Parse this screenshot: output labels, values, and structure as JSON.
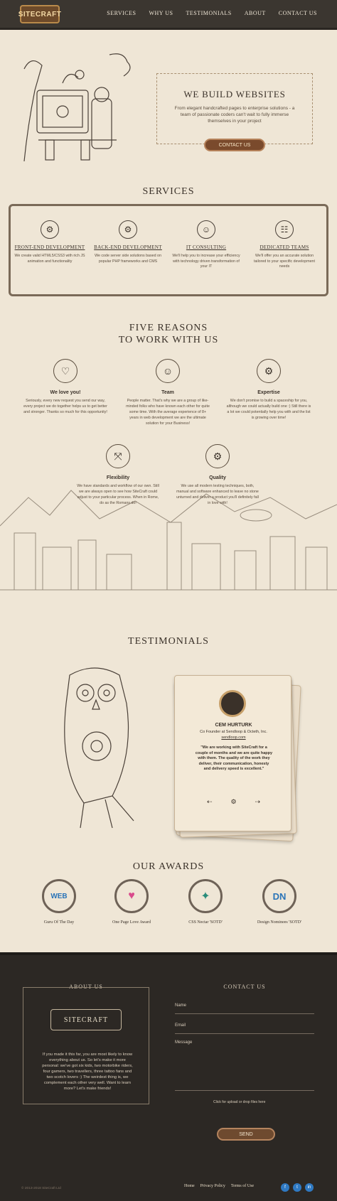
{
  "nav": {
    "logo_text": "SITECRAFT",
    "items": [
      "SERVICES",
      "WHY US",
      "TESTIMONIALS",
      "ABOUT",
      "CONTACT US"
    ]
  },
  "hero": {
    "title": "WE BUILD WEBSITES",
    "text": "From elegant handcrafted pages to enterprise solutions - a team of passionate coders can't wait to fully immerse themselves in your project",
    "cta": "CONTACT US"
  },
  "services": {
    "title": "SERVICES",
    "items": [
      {
        "label": "FRONT-END DEVELOPMENT",
        "text": "We create valid HTML5/CSS3 with rich JS animation and functionality"
      },
      {
        "label": "BACK-END DEVELOPMENT",
        "text": "We code server side solutions based on popular PHP frameworks and CMS"
      },
      {
        "label": "IT CONSULTING",
        "text": "We'll help you to increase your efficiency with technology driven transformation of your IT"
      },
      {
        "label": "DEDICATED TEAMS",
        "text": "We'll offer you an accurate solution tailored to your specific development needs"
      }
    ]
  },
  "reasons": {
    "title_line1": "FIVE REASONS",
    "title_line2": "TO WORK WITH US",
    "items": [
      {
        "title": "We love you!",
        "text": "Seriously, every new request you send our way, every project we do together helps us to get better and stronger. Thanks so much for this opportunity!"
      },
      {
        "title": "Team",
        "text": "People matter. That's why we are a group of like-minded folks who have known each other for quite some time. With the average experience of 8+ years in web development we are the ultimate solution for your Business!"
      },
      {
        "title": "Expertise",
        "text": "We don't promise to build a spaceship for you, although we could actually build one :) Still there is a lot we could potentially help you with and the list is growing over time!"
      },
      {
        "title": "Flexibility",
        "text": "We have standards and workflow of our own. Still we are always open to see how SiteCraft could adjust to your particular process. When in Rome, do as the Romans do!"
      },
      {
        "title": "Quality",
        "text": "We use all modern testing techniques, both, manual and software enhanced to leave no stone unturned and deliver a product you'll definitely fall in love with!"
      }
    ]
  },
  "testimonials": {
    "title": "TESTIMONIALS",
    "name": "CEM HURTURK",
    "role": "Co Founder at Sendloop & Octeth, Inc.",
    "site": "sendloop.com",
    "quote": "\"We are working with SiteCraft for a couple of months and we are quite happy with them. The quality of the work they deliver, their communication, honesty and delivery speed is excellent.\""
  },
  "awards": {
    "title": "OUR AWARDS",
    "items": [
      {
        "label": "Guru Of The Day",
        "badge": "WEB"
      },
      {
        "label": "One Page Love Award",
        "badge": "♥"
      },
      {
        "label": "CSS Nectar 'SOTD'",
        "badge": "✦"
      },
      {
        "label": "Design Nominees 'SOTD'",
        "badge": "DN"
      }
    ]
  },
  "footer": {
    "about_title": "ABOUT US",
    "contact_title": "CONTACT US",
    "about_logo": "SITECRAFT",
    "about_text": "If you made it this far, you are most likely to know everything about us. So let's make it more personal: we've got six kids, two motorbike riders, four gamers, two travellers, three tattoo fans and two scotch lovers :) The weirdest thing is, we complement each other very well. Want to learn more? Let's make friends!",
    "fields": [
      "Name",
      "Email",
      "Message"
    ],
    "upload": "Click for upload or drop files here",
    "send": "SEND",
    "copyright": "© 2013-2018 SiteCraft Ltd",
    "links": [
      "Home",
      "Privacy Policy",
      "Terms of Use"
    ]
  },
  "colors": {
    "background": "#efe6d6",
    "header": "#3b3630",
    "footer": "#2c2824",
    "accent_button": "#7a4a2c",
    "social": "#2f79c2"
  }
}
